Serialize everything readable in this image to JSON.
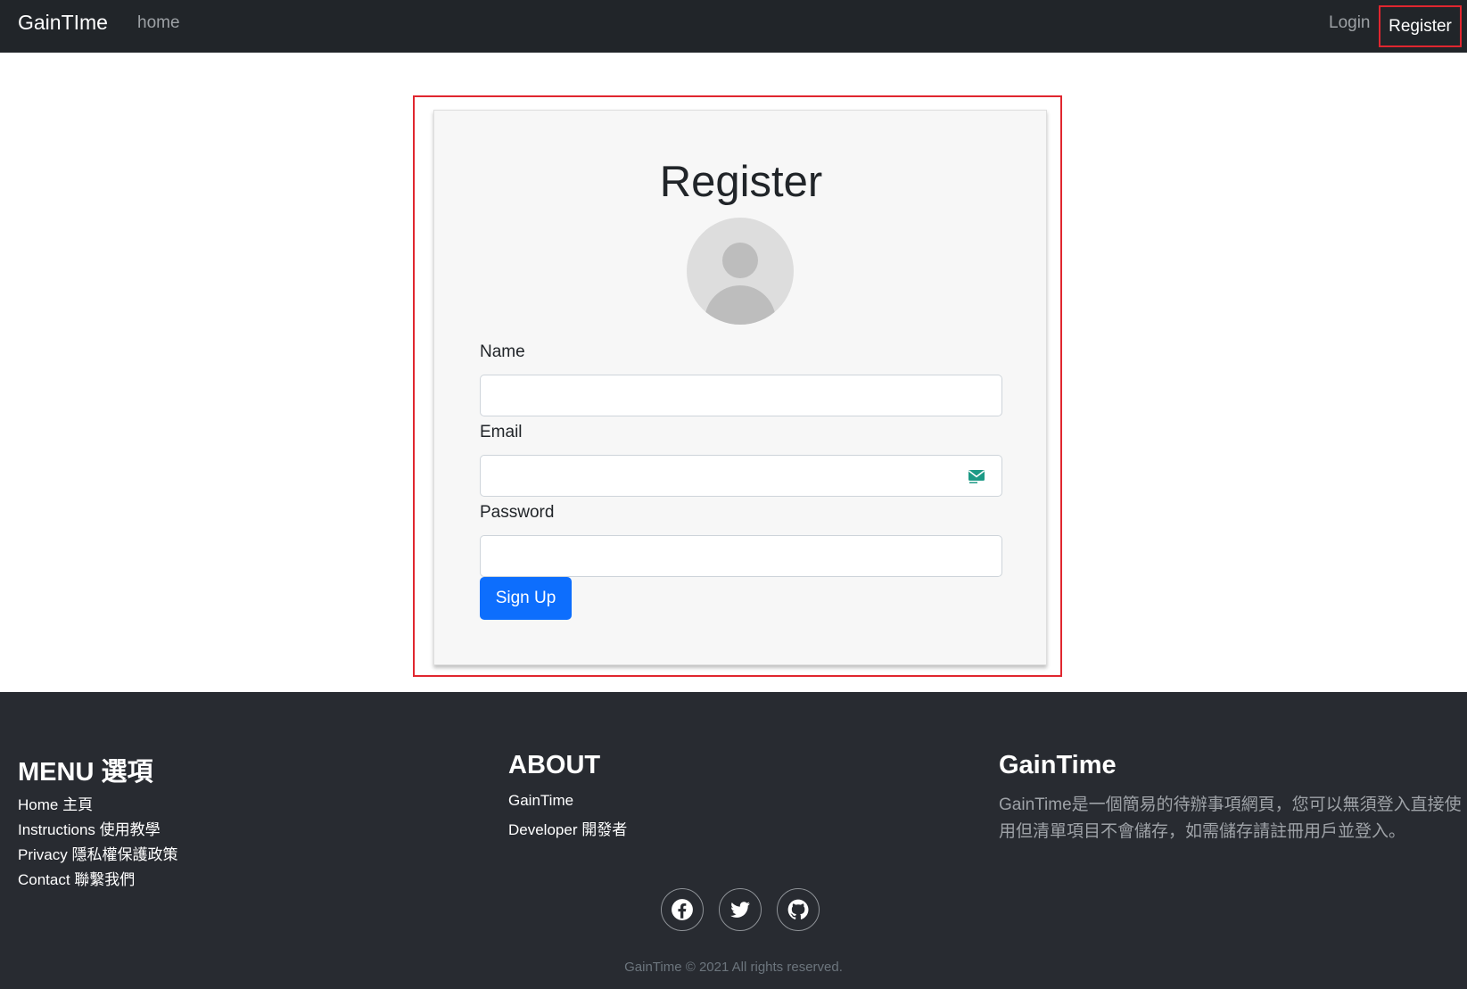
{
  "navbar": {
    "brand": "GainTIme",
    "home": "home",
    "login": "Login",
    "register": "Register"
  },
  "card": {
    "title": "Register",
    "name_label": "Name",
    "email_label": "Email",
    "password_label": "Password",
    "name_value": "",
    "email_value": "",
    "password_value": "",
    "submit": "Sign Up"
  },
  "footer": {
    "menu": {
      "heading": "MENU 選項",
      "items": [
        "Home 主頁",
        "Instructions 使用教學",
        "Privacy 隱私權保護政策",
        "Contact 聯繫我們"
      ]
    },
    "about": {
      "heading": "ABOUT",
      "items": [
        "GainTime",
        "Developer 開發者"
      ]
    },
    "brand": {
      "heading": "GainTime",
      "description": "GainTime是一個簡易的待辦事項網頁，您可以無須登入直接使用但清單項目不會儲存，如需儲存請註冊用戶並登入。"
    },
    "social": [
      "facebook-icon",
      "twitter-icon",
      "github-icon"
    ],
    "copyright": "GainTime © 2021 All rights reserved."
  },
  "colors": {
    "navbar_bg": "#212529",
    "footer_bg": "#282b31",
    "primary": "#0d6efd",
    "highlight": "#e0262f"
  }
}
